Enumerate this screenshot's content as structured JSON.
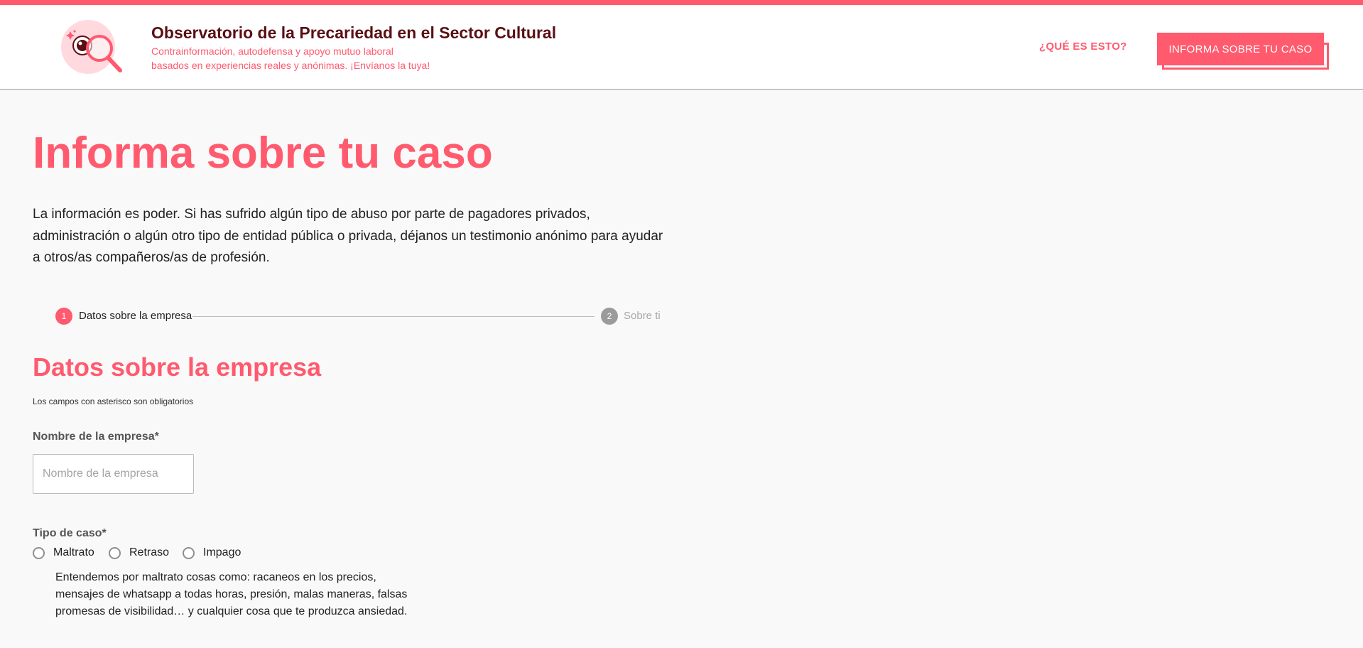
{
  "header": {
    "title": "Observatorio de la Precariedad en el Sector Cultural",
    "subtitle_line1": "Contrainformación, autodefensa y apoyo mutuo laboral",
    "subtitle_line2": "basados en experiencias reales y anónimas. ¡Envíanos la tuya!",
    "nav_link": "¿QUÉ ES ESTO?",
    "cta_label": "INFORMA SOBRE TU CASO"
  },
  "main": {
    "title": "Informa sobre tu caso",
    "intro": "La información es poder. Si has sufrido algún tipo de abuso por parte de pagadores privados, administración o algún otro tipo de entidad pública o privada, déjanos un testimonio anónimo para ayudar a otros/as compañeros/as de profesión."
  },
  "stepper": {
    "steps": [
      {
        "number": "1",
        "label": "Datos sobre la empresa",
        "active": true
      },
      {
        "number": "2",
        "label": "Sobre ti",
        "active": false
      }
    ]
  },
  "form": {
    "section_title": "Datos sobre la empresa",
    "required_hint": "Los campos con asterisco son obligatorios",
    "company_label": "Nombre de la empresa*",
    "company_placeholder": "Nombre de la empresa",
    "company_value": "",
    "case_type_label": "Tipo de caso*",
    "case_type_options": [
      "Maltrato",
      "Retraso",
      "Impago"
    ],
    "case_type_help": "Entendemos por maltrato cosas como: racaneos en los precios, mensajes de whatsapp a todas horas, presión, malas maneras, falsas promesas de visibilidad… y cualquier cosa que te produzca ansiedad."
  },
  "colors": {
    "accent": "#ff5a6e",
    "brand_dark": "#5a0f14",
    "inactive_step": "#9b9b9b",
    "background": "#f9f9f9"
  },
  "icons": {
    "logo": "magnifying-glass-eye-icon"
  }
}
